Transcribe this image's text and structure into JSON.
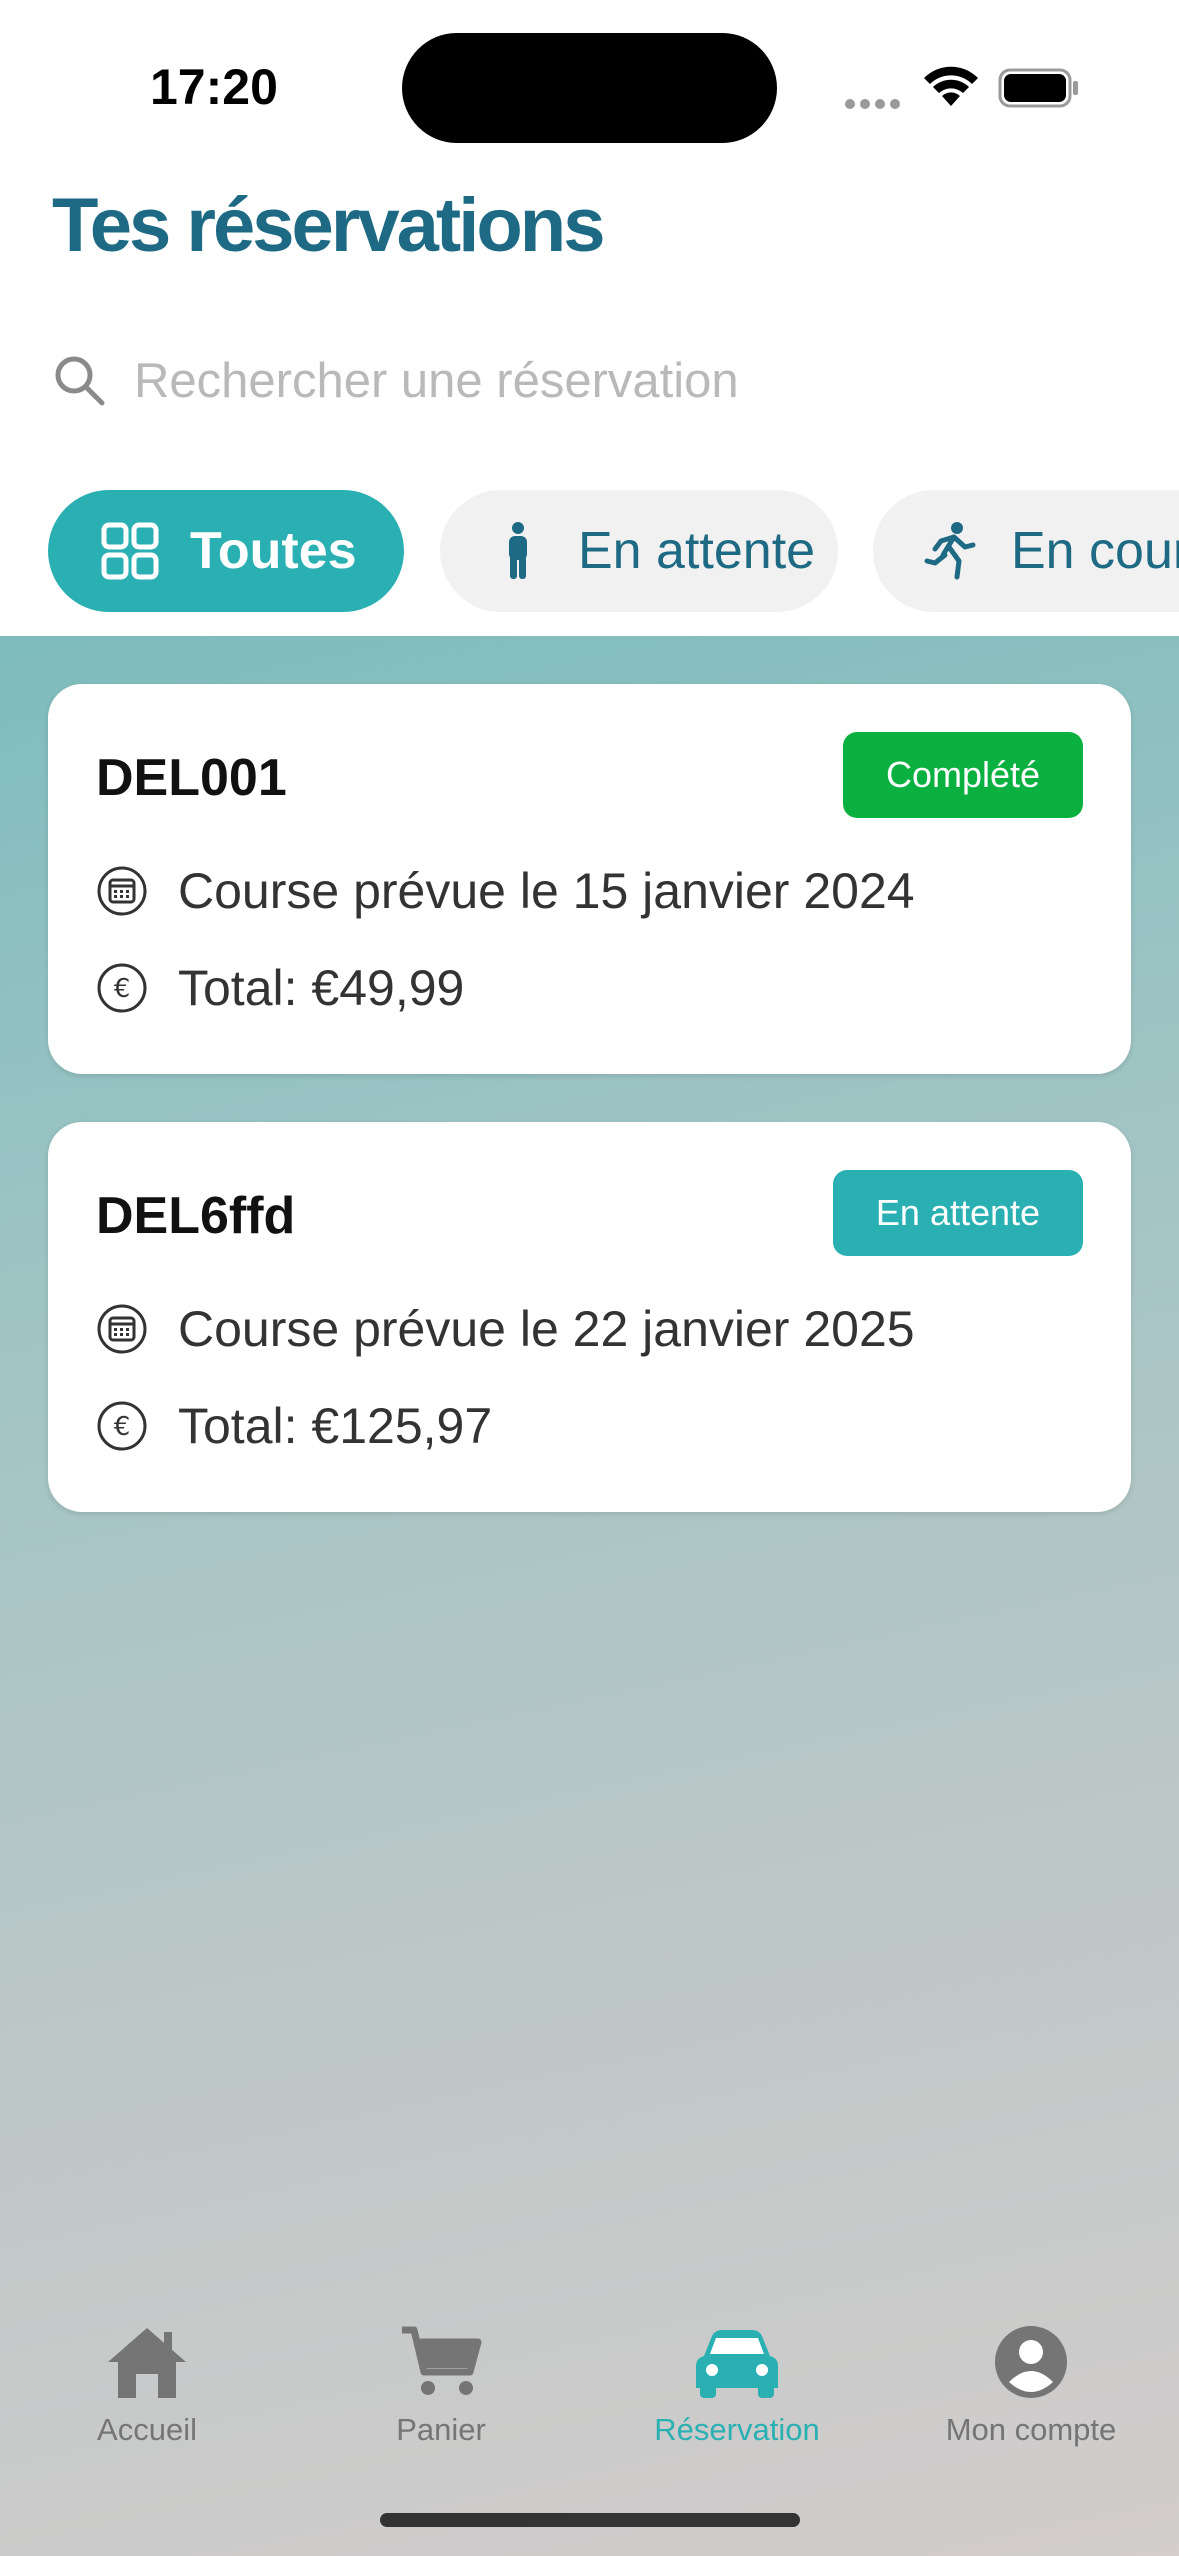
{
  "status_bar": {
    "time": "17:20"
  },
  "header": {
    "title": "Tes réservations"
  },
  "search": {
    "placeholder": "Rechercher une réservation"
  },
  "filters": [
    {
      "label": "Toutes",
      "icon": "grid-icon",
      "active": true
    },
    {
      "label": "En attente",
      "icon": "person-standing-icon",
      "active": false
    },
    {
      "label": "En cours",
      "icon": "person-running-icon",
      "active": false
    }
  ],
  "reservations": [
    {
      "id": "DEL001",
      "status": "Complété",
      "date_text": "Course prévue le 15 janvier 2024",
      "total_text": "Total: €49,99"
    },
    {
      "id": "DEL6ffd",
      "status": "En attente",
      "date_text": "Course prévue le 22 janvier 2025",
      "total_text": "Total: €125,97"
    }
  ],
  "tabbar": {
    "items": [
      {
        "label": "Accueil",
        "icon": "home-icon",
        "active": false
      },
      {
        "label": "Panier",
        "icon": "cart-icon",
        "active": false
      },
      {
        "label": "Réservation",
        "icon": "car-icon",
        "active": true
      },
      {
        "label": "Mon compte",
        "icon": "account-icon",
        "active": false
      }
    ]
  },
  "colors": {
    "title": "#1e6a84",
    "accent": "#2ab0b2",
    "status_complete": "#0bb140",
    "status_waiting": "#2ab0b2"
  }
}
